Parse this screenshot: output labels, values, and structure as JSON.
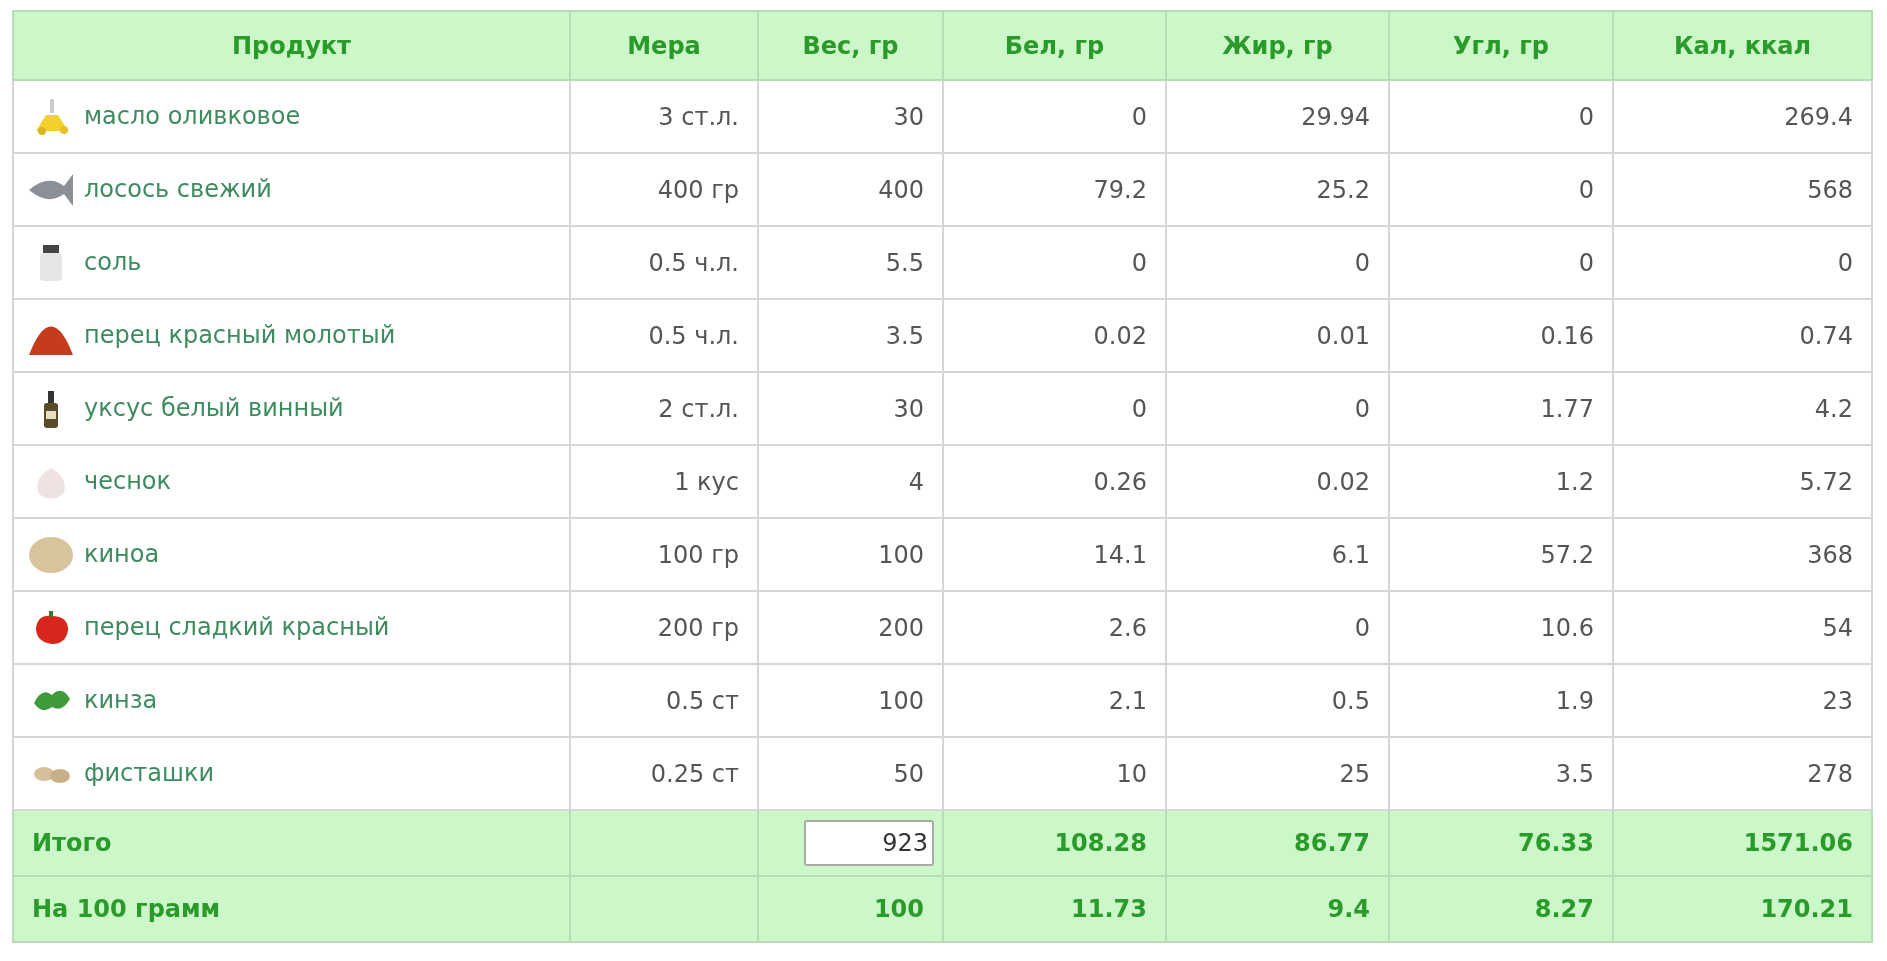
{
  "columns": [
    "Продукт",
    "Мера",
    "Вес, гр",
    "Бел, гр",
    "Жир, гр",
    "Угл, гр",
    "Кал, ккал"
  ],
  "rows": [
    {
      "product": "масло оливковое",
      "measure": "3 ст.л.",
      "weight": "30",
      "protein": "0",
      "fat": "29.94",
      "carbs": "0",
      "kcal": "269.4"
    },
    {
      "product": "лосось свежий",
      "measure": "400 гр",
      "weight": "400",
      "protein": "79.2",
      "fat": "25.2",
      "carbs": "0",
      "kcal": "568"
    },
    {
      "product": "соль",
      "measure": "0.5 ч.л.",
      "weight": "5.5",
      "protein": "0",
      "fat": "0",
      "carbs": "0",
      "kcal": "0"
    },
    {
      "product": "перец красный молотый",
      "measure": "0.5 ч.л.",
      "weight": "3.5",
      "protein": "0.02",
      "fat": "0.01",
      "carbs": "0.16",
      "kcal": "0.74"
    },
    {
      "product": "уксус белый винный",
      "measure": "2 ст.л.",
      "weight": "30",
      "protein": "0",
      "fat": "0",
      "carbs": "1.77",
      "kcal": "4.2"
    },
    {
      "product": "чеснок",
      "measure": "1 кус",
      "weight": "4",
      "protein": "0.26",
      "fat": "0.02",
      "carbs": "1.2",
      "kcal": "5.72"
    },
    {
      "product": "киноа",
      "measure": "100 гр",
      "weight": "100",
      "protein": "14.1",
      "fat": "6.1",
      "carbs": "57.2",
      "kcal": "368"
    },
    {
      "product": "перец сладкий красный",
      "measure": "200 гр",
      "weight": "200",
      "protein": "2.6",
      "fat": "0",
      "carbs": "10.6",
      "kcal": "54"
    },
    {
      "product": "кинза",
      "measure": "0.5 ст",
      "weight": "100",
      "protein": "2.1",
      "fat": "0.5",
      "carbs": "1.9",
      "kcal": "23"
    },
    {
      "product": "фисташки",
      "measure": "0.25 ст",
      "weight": "50",
      "protein": "10",
      "fat": "25",
      "carbs": "3.5",
      "kcal": "278"
    }
  ],
  "totals": [
    {
      "label": "Итого",
      "kind": "editable",
      "weight": "923",
      "protein": "108.28",
      "fat": "86.77",
      "carbs": "76.33",
      "kcal": "1571.06"
    },
    {
      "label": "На 100 грамм",
      "kind": "fixed",
      "weight": "100",
      "protein": "11.73",
      "fat": "9.4",
      "carbs": "8.27",
      "kcal": "170.21"
    }
  ]
}
